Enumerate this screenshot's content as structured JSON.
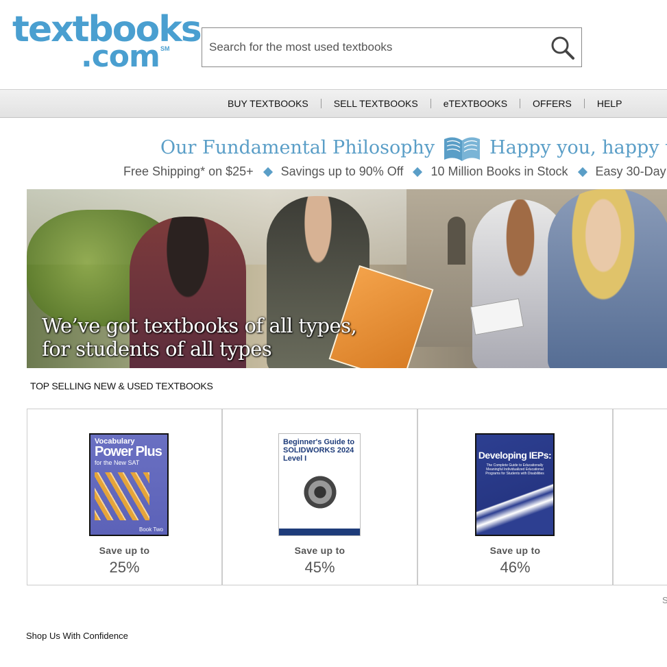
{
  "header": {
    "logo_line1": "textbooks",
    "logo_line2": ".com",
    "logo_sm": "SM",
    "search_placeholder": "Search for the most used textbooks"
  },
  "nav": {
    "items": [
      "BUY TEXTBOOKS",
      "SELL TEXTBOOKS",
      "eTEXTBOOKS",
      "OFFERS",
      "HELP"
    ]
  },
  "philosophy": {
    "left": "Our Fundamental Philosophy",
    "right": "Happy you, happy us"
  },
  "benefits": [
    "Free Shipping* on $25+",
    "Savings up to 90% Off",
    "10 Million Books in Stock",
    "Easy 30-Day"
  ],
  "hero": {
    "line1": "We’ve got textbooks of all types,",
    "line2": "for students of all types"
  },
  "top_selling": {
    "title": "TOP SELLING NEW & USED TEXTBOOKS",
    "books": [
      {
        "cover_title_1": "Vocabulary",
        "cover_title_2": "Power Plus",
        "cover_subtitle": "for the New SAT",
        "cover_book_no": "Book Two",
        "save_label": "Save up to",
        "save_pct": "25%"
      },
      {
        "cover_title_1": "Beginner's Guide to SOLIDWORKS 2024",
        "cover_title_2": "Level I",
        "save_label": "Save up to",
        "save_pct": "45%"
      },
      {
        "cover_title_1": "Developing IEPs:",
        "cover_subtitle": "The Complete Guide to Educationally Meaningful Individualized Educational Programs for Students with Disabilities",
        "save_label": "Save up to",
        "save_pct": "46%"
      }
    ]
  },
  "scroll_hint": "S",
  "confidence": "Shop Us With Confidence",
  "colors": {
    "brand_blue": "#4a9fd0",
    "philosophy_blue": "#5a9ec7"
  }
}
